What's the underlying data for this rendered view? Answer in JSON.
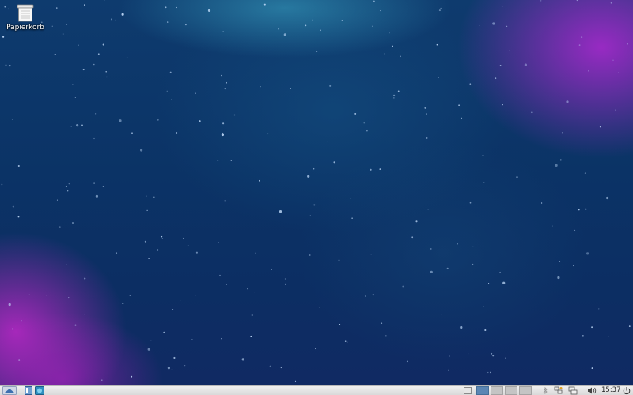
{
  "desktop": {
    "icons": [
      {
        "label": "Papierkorb",
        "icon": "trash-icon"
      }
    ],
    "wallpaper_colors": {
      "base": "#0c3366",
      "glow_purple": "#b028d2",
      "glow_cyan": "#3caac8"
    }
  },
  "panel": {
    "launchers": [
      {
        "icon": "app-menu-icon"
      },
      {
        "icon": "file-manager-icon"
      },
      {
        "icon": "web-browser-icon"
      }
    ],
    "workspaces": {
      "count": 4,
      "active": 1
    },
    "tray": [
      "bluetooth-icon",
      "network-icon",
      "display-icon",
      "volume-icon"
    ],
    "clock": "15:37",
    "accent": "#5b86b4"
  }
}
